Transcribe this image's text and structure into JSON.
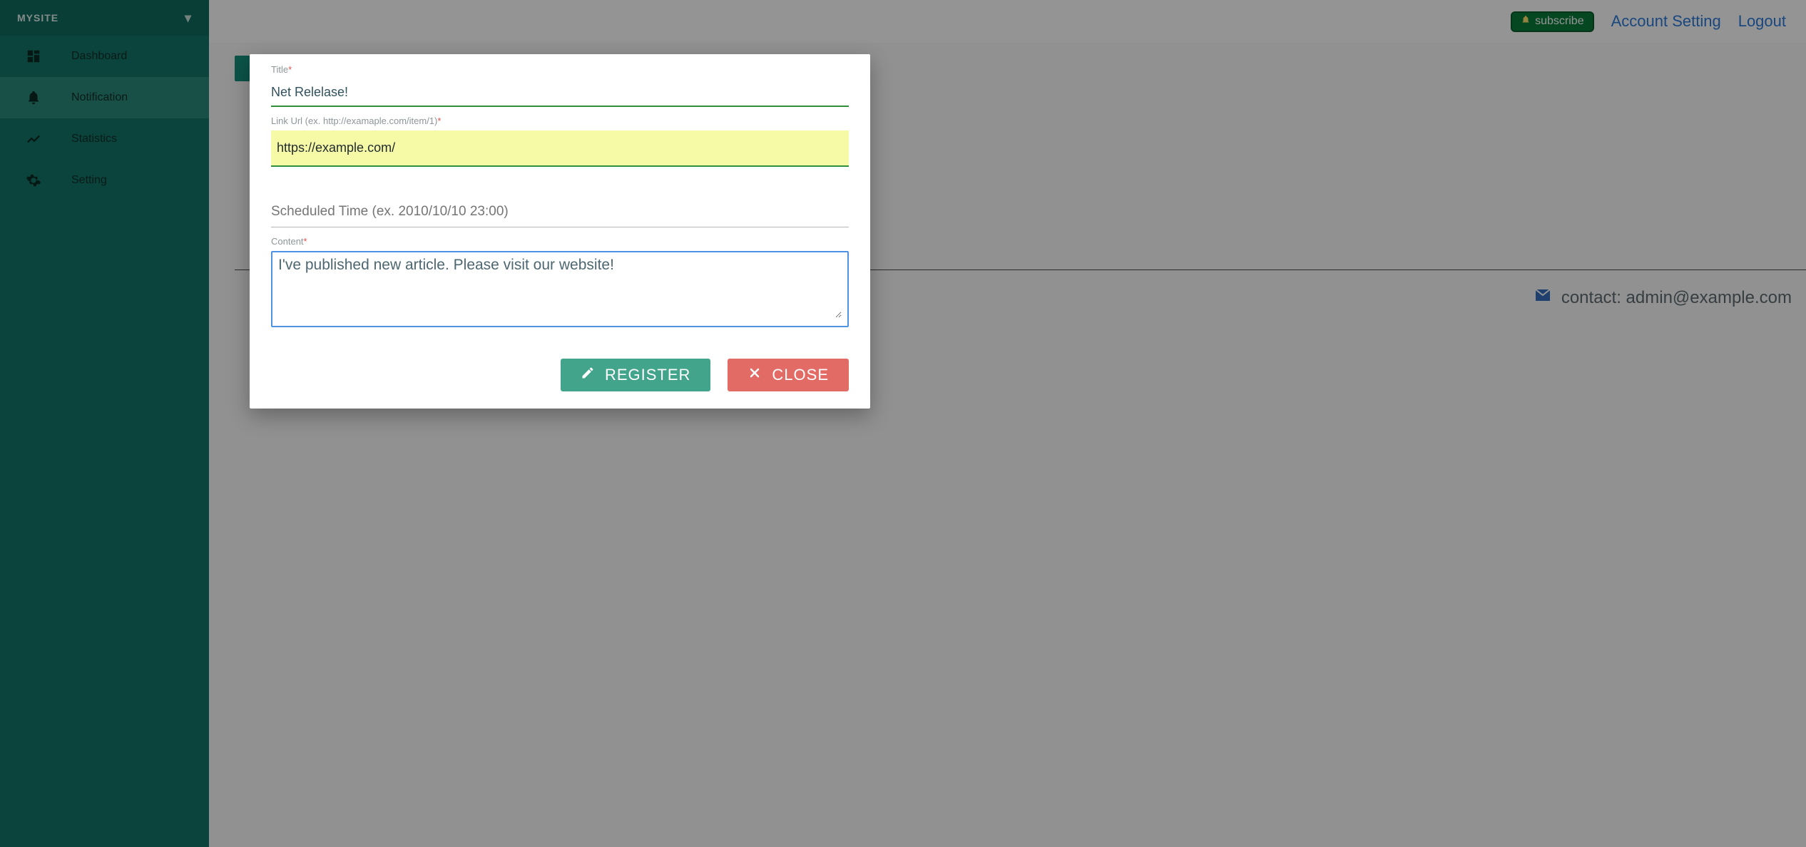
{
  "sidebar": {
    "title": "MYSITE",
    "items": [
      {
        "label": "Dashboard",
        "icon": "dashboard-icon",
        "active": false
      },
      {
        "label": "Notification",
        "icon": "bell-icon",
        "active": true
      },
      {
        "label": "Statistics",
        "icon": "chart-line-icon",
        "active": false
      },
      {
        "label": "Setting",
        "icon": "gear-icon",
        "active": false
      }
    ]
  },
  "topbar": {
    "subscribe_label": "subscribe",
    "account_setting_label": "Account Setting",
    "logout_label": "Logout"
  },
  "footer": {
    "contact_text": "contact: admin@example.com"
  },
  "modal": {
    "title_label": "Title",
    "title_value": "Net Relelase!",
    "link_label": "Link Url (ex. http://examaple.com/item/1)",
    "link_value": "https://example.com/",
    "scheduled_placeholder": "Scheduled Time (ex. 2010/10/10 23:00)",
    "scheduled_value": "",
    "content_label": "Content",
    "content_value": "I've published new article. Please visit our website!",
    "register_label": "REGISTER",
    "close_label": "CLOSE"
  },
  "colors": {
    "teal": "#158f7d",
    "teal_dark": "#147668",
    "accent_green": "#2f8f3a",
    "danger": "#e26b66",
    "link_blue": "#2b7bd9"
  }
}
